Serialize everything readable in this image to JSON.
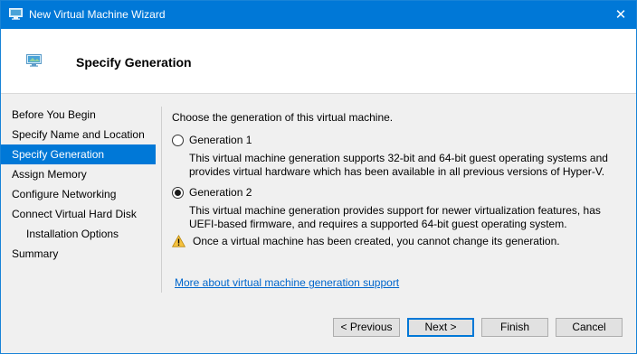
{
  "window": {
    "title": "New Virtual Machine Wizard",
    "close_glyph": "✕",
    "accent_color": "#0078d7",
    "icon": "virtual-machine-icon"
  },
  "header": {
    "title": "Specify Generation",
    "icon": "virtual-machine-icon"
  },
  "nav": {
    "items": [
      {
        "label": "Before You Begin",
        "selected": false
      },
      {
        "label": "Specify Name and Location",
        "selected": false
      },
      {
        "label": "Specify Generation",
        "selected": true
      },
      {
        "label": "Assign Memory",
        "selected": false
      },
      {
        "label": "Configure Networking",
        "selected": false
      },
      {
        "label": "Connect Virtual Hard Disk",
        "selected": false
      },
      {
        "label": "Installation Options",
        "selected": false,
        "indent": true
      },
      {
        "label": "Summary",
        "selected": false
      }
    ]
  },
  "main": {
    "prompt": "Choose the generation of this virtual machine.",
    "options": [
      {
        "label": "Generation 1",
        "checked": false,
        "description": "This virtual machine generation supports 32-bit and 64-bit guest operating systems and provides virtual hardware which has been available in all previous versions of Hyper-V."
      },
      {
        "label": "Generation 2",
        "checked": true,
        "description": "This virtual machine generation provides support for newer virtualization features, has UEFI-based firmware, and requires a supported 64-bit guest operating system."
      }
    ],
    "warning": "Once a virtual machine has been created, you cannot change its generation.",
    "warning_icon": "warning-icon",
    "link": "More about virtual machine generation support"
  },
  "buttons": {
    "previous": "< Previous",
    "next": "Next >",
    "finish": "Finish",
    "cancel": "Cancel"
  }
}
